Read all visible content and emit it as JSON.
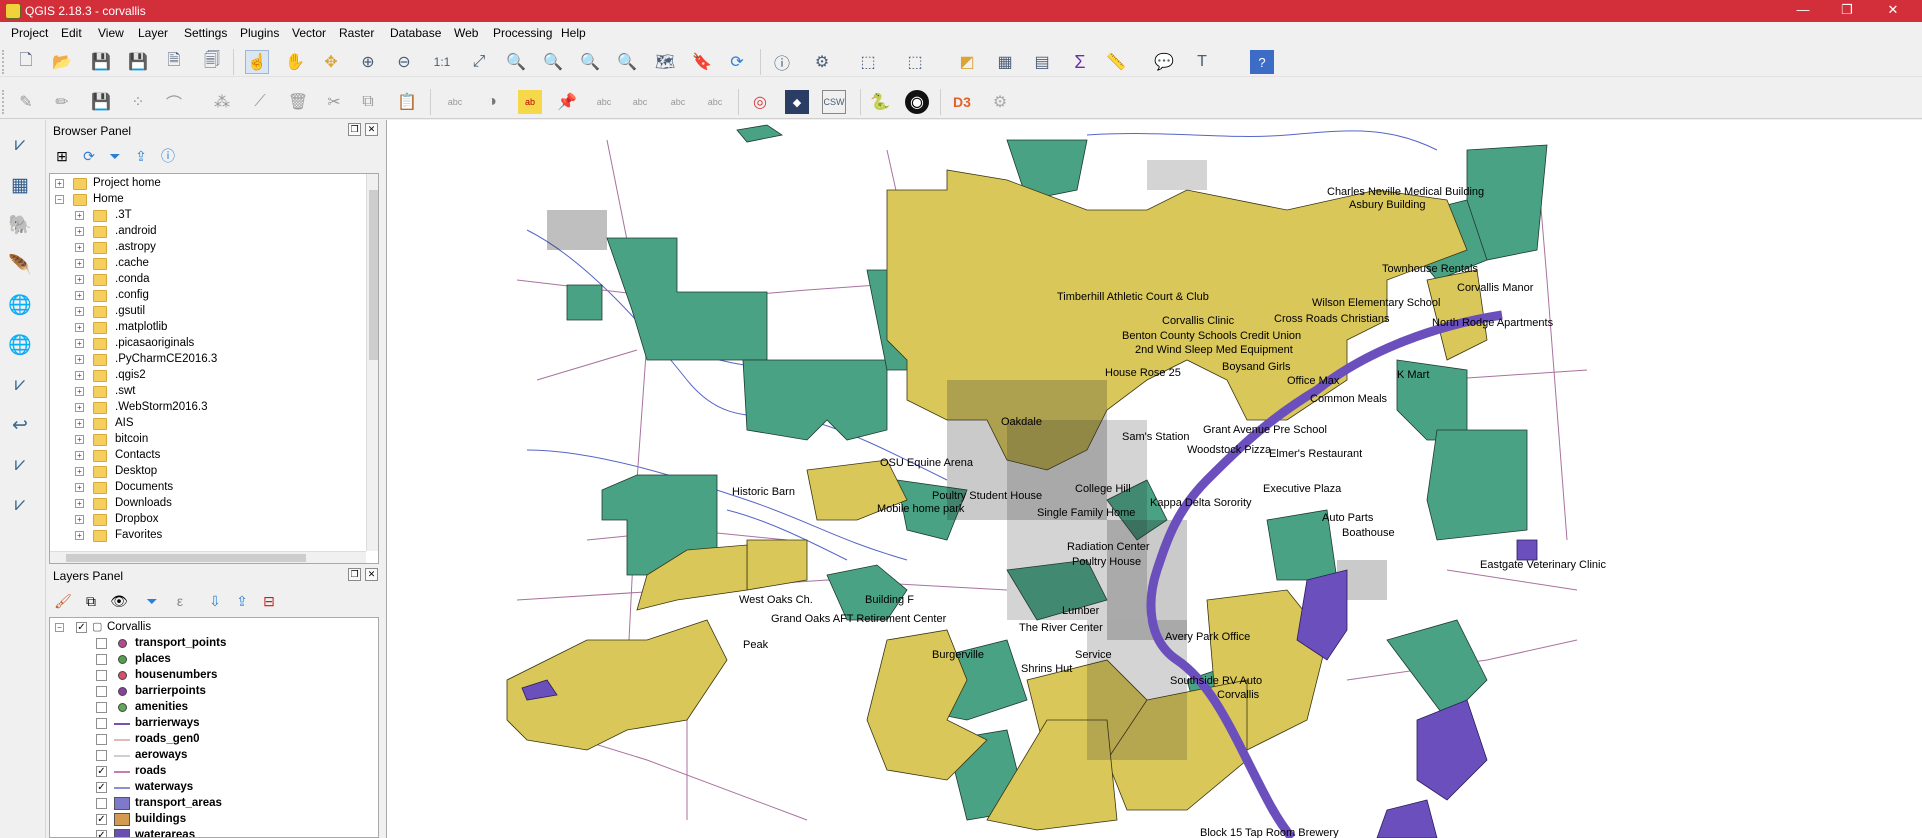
{
  "window": {
    "title": "QGIS 2.18.3 - corvallis",
    "controls": [
      "—",
      "❐",
      "✕"
    ]
  },
  "menu": [
    "Project",
    "Edit",
    "View",
    "Layer",
    "Settings",
    "Plugins",
    "Vector",
    "Raster",
    "Database",
    "Web",
    "Processing",
    "Help"
  ],
  "browser": {
    "title": "Browser Panel",
    "items": [
      "Project home",
      "Home",
      ".3T",
      ".android",
      ".astropy",
      ".cache",
      ".conda",
      ".config",
      ".gsutil",
      ".matplotlib",
      ".picasaoriginals",
      ".PyCharmCE2016.3",
      ".qgis2",
      ".swt",
      ".WebStorm2016.3",
      "AIS",
      "bitcoin",
      "Contacts",
      "Desktop",
      "Documents",
      "Downloads",
      "Dropbox",
      "Favorites"
    ]
  },
  "layers": {
    "title": "Layers Panel",
    "group": "Corvallis",
    "items": [
      {
        "name": "transport_points",
        "checked": false,
        "symbol": "point",
        "color": "#b34a8f"
      },
      {
        "name": "places",
        "checked": false,
        "symbol": "point",
        "color": "#4da34a"
      },
      {
        "name": "housenumbers",
        "checked": false,
        "symbol": "point",
        "color": "#d94f6b"
      },
      {
        "name": "barrierpoints",
        "checked": false,
        "symbol": "point",
        "color": "#8b3fa3"
      },
      {
        "name": "amenities",
        "checked": false,
        "symbol": "point",
        "color": "#5cab56"
      },
      {
        "name": "barrierways",
        "checked": false,
        "symbol": "line",
        "color": "#7b4fb0"
      },
      {
        "name": "roads_gen0",
        "checked": false,
        "symbol": "line",
        "color": "#e3b9b9"
      },
      {
        "name": "aeroways",
        "checked": false,
        "symbol": "line",
        "color": "#cfcfcf"
      },
      {
        "name": "roads",
        "checked": true,
        "symbol": "line",
        "color": "#c77db3"
      },
      {
        "name": "waterways",
        "checked": true,
        "symbol": "line",
        "color": "#8a8fd6"
      },
      {
        "name": "transport_areas",
        "checked": false,
        "symbol": "polygon",
        "color": "#7f79cc"
      },
      {
        "name": "buildings",
        "checked": true,
        "symbol": "polygon",
        "color": "#d49a52"
      },
      {
        "name": "waterareas",
        "checked": true,
        "symbol": "polygon",
        "color": "#6950b3"
      }
    ]
  },
  "map": {
    "colors": {
      "landuse_green": "#48a283",
      "residential_yellow": "#d9c75a",
      "water": "#6b4fbc",
      "roads": "#a9729f",
      "waterways": "#5565c8"
    },
    "labels": [
      "Charles Neville Medical Building",
      "Asbury Building",
      "Townhouse Rentals",
      "Corvallis Manor",
      "Timberhill Athletic Court & Club",
      "Wilson Elementary School",
      "Corvallis Clinic",
      "Cross Roads Christians",
      "North Rodge Apartments",
      "Benton County Schools Credit Union",
      "2nd Wind Sleep Med Equipment",
      "House Rose 25",
      "Boysand Girls",
      "Office Max",
      "K Mart",
      "Oakdale",
      "Common Meals",
      "Sam's Station",
      "Grant Avenue Pre School",
      "Woodstock Pizza",
      "Elmer's Restaurant",
      "OSU Equine Arena",
      "Historic Barn",
      "Poultry Student House",
      "College Hill",
      "Executive Plaza",
      "Mobile home park",
      "Single Family Home",
      "Kappa Delta Sorority",
      "Auto Parts",
      "Boathouse",
      "Eastgate Veterinary Clinic",
      "Radiation Center",
      "Poultry House",
      "West Oaks Ch.",
      "Building F",
      "Grand Oaks AFT Retirement Center",
      "Lumber",
      "The River Center",
      "Avery Park Office",
      "Peak",
      "Burgerville",
      "Service",
      "Shrins Hut",
      "Southside RV Auto",
      "Corvallis",
      "Block 15 Tap Room Brewery"
    ]
  }
}
